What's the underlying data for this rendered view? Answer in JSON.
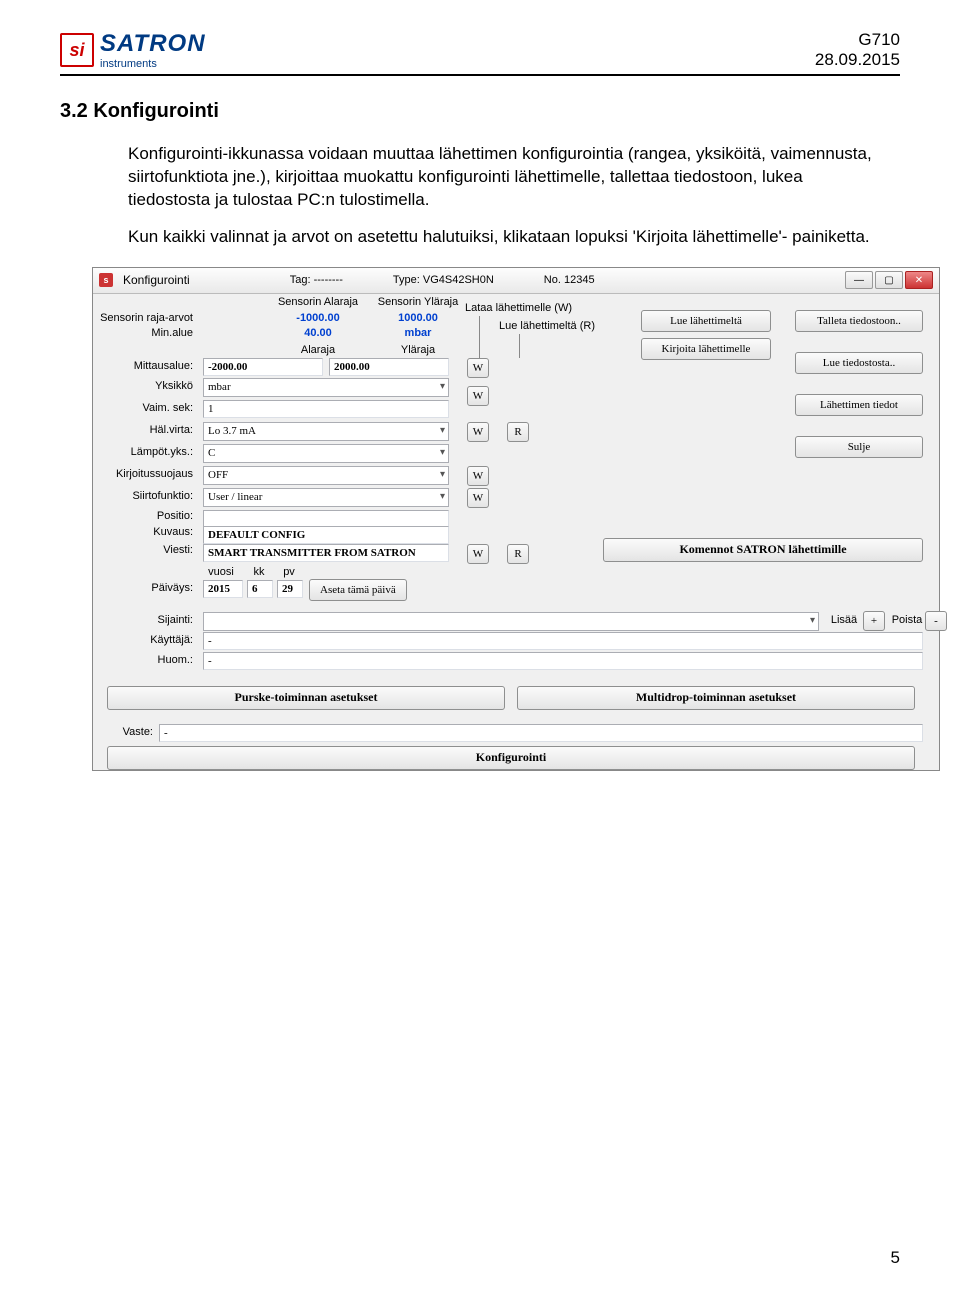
{
  "header": {
    "doc_id": "G710",
    "date": "28.09.2015",
    "logo_main": "SATRON",
    "logo_sub": "instruments",
    "logo_badge": "si"
  },
  "section": {
    "num_title": "3.2 Konfigurointi"
  },
  "paragraphs": {
    "p1": "Konfigurointi-ikkunassa voidaan muuttaa lähettimen konfigurointia (rangea, yksiköitä, vaimennusta, siirtofunktiota jne.), kirjoittaa muokattu konfigurointi lähettimelle, tallettaa tiedostoon, lukea tiedostosta ja tulostaa PC:n tulostimella.",
    "p2": "Kun kaikki valinnat ja arvot on asetettu halutuiksi, klikataan lopuksi 'Kirjoita lähettimelle'- painiketta."
  },
  "app": {
    "title": "Konfigurointi",
    "tag_lbl": "Tag:",
    "tag_val": "--------",
    "type_lbl": "Type:",
    "type_val": "VG4S42SH0N",
    "no_lbl": "No.",
    "no_val": "12345",
    "hdr_sens_lo": "Sensorin Alaraja",
    "hdr_sens_hi": "Sensorin Yläraja",
    "lbl_sens_range": "Sensorin raja-arvot",
    "lbl_min_range": "Min.alue",
    "sens_lo": "-1000.00",
    "sens_hi": "1000.00",
    "min_lo": "40.00",
    "min_hi": "mbar",
    "hdr_lo": "Alaraja",
    "hdr_hi": "Yläraja",
    "lbl_mitta": "Mittausalue:",
    "mitta_lo": "-2000.00",
    "mitta_hi": "2000.00",
    "lbl_unit": "Yksikkö",
    "unit": "mbar",
    "lbl_vaim": "Vaim. sek:",
    "vaim": "1",
    "lbl_hal": "Häl.virta:",
    "hal": "Lo 3.7 mA",
    "lbl_lampo": "Lämpöt.yks.:",
    "lampo": "C",
    "lbl_kirj": "Kirjoitussuojaus",
    "kirj": "OFF",
    "lbl_siirto": "Siirtofunktio:",
    "siirto": "User / linear",
    "lbl_positio": "Positio:",
    "positio": "",
    "lbl_kuvaus": "Kuvaus:",
    "kuvaus": "DEFAULT CONFIG",
    "lbl_viesti": "Viesti:",
    "viesti": "SMART TRANSMITTER FROM SATRON",
    "lbl_paivays": "Päiväys:",
    "lbl_vuosi": "vuosi",
    "lbl_kk": "kk",
    "lbl_pv": "pv",
    "vuosi": "2015",
    "kk": "6",
    "pv": "29",
    "aseta": "Aseta tämä päivä",
    "lbl_sijainti": "Sijainti:",
    "lbl_kaytt": "Käyttäjä:",
    "kaytt": "-",
    "lbl_huom": "Huom.:",
    "huom": "-",
    "lisaa": "Lisää",
    "poista": "Poista",
    "lbl_lataa": "Lataa lähettimelle (W)",
    "lbl_lue": "Lue lähettimeltä (R)",
    "btn_lue": "Lue lähettimeltä",
    "btn_kirjoita": "Kirjoita lähettimelle",
    "btn_talleta": "Talleta tiedostoon..",
    "btn_luef": "Lue tiedostosta..",
    "btn_tiedot": "Lähettimen tiedot",
    "btn_sulje": "Sulje",
    "komennot": "Komennot SATRON lähettimille",
    "purske": "Purske-toiminnan asetukset",
    "multidrop": "Multidrop-toiminnan asetukset",
    "lbl_vaste": "Vaste:",
    "vaste": "-",
    "foot": "Konfigurointi",
    "W": "W",
    "R": "R",
    "plus": "+",
    "minus": "-"
  },
  "page_number": "5"
}
